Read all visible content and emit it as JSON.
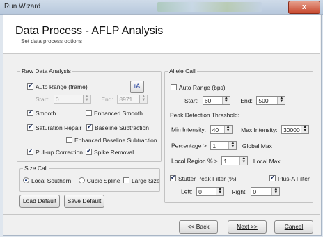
{
  "window": {
    "title": "Run Wizard",
    "close_glyph": "x"
  },
  "header": {
    "title": "Data Process - AFLP Analysis",
    "subtitle": "Set data process options"
  },
  "raw_data": {
    "legend": "Raw Data Analysis",
    "auto_range_label": "Auto Range (frame)",
    "auto_range_checked": true,
    "start_label": "Start:",
    "start_value": "0",
    "end_label": "End:",
    "end_value": "8971",
    "icon_button_text": "tA",
    "smooth_label": "Smooth",
    "smooth_checked": true,
    "enhanced_smooth_label": "Enhanced Smooth",
    "enhanced_smooth_checked": false,
    "saturation_repair_label": "Saturation Repair",
    "saturation_repair_checked": true,
    "baseline_subtraction_label": "Baseline Subtraction",
    "baseline_subtraction_checked": true,
    "enhanced_baseline_label": "Enhanced Baseline Subtraction",
    "enhanced_baseline_checked": false,
    "pullup_label": "Pull-up Correction",
    "pullup_checked": true,
    "spike_label": "Spike Removal",
    "spike_checked": true
  },
  "size_call": {
    "legend": "Size Call",
    "local_southern_label": "Local Southern",
    "cubic_spline_label": "Cubic Spline",
    "large_size_label": "Large Size",
    "selected": "Local Southern"
  },
  "allele_call": {
    "legend": "Allele Call",
    "auto_range_label": "Auto Range (bps)",
    "auto_range_checked": false,
    "start_label": "Start:",
    "start_value": "60",
    "end_label": "End:",
    "end_value": "500",
    "peak_threshold_label": "Peak Detection Threshold:",
    "min_intensity_label": "Min Intensity:",
    "min_intensity_value": "40",
    "max_intensity_label": "Max Intensity:",
    "max_intensity_value": "30000",
    "percentage_label": "Percentage >",
    "percentage_value": "1",
    "global_max_label": "Global Max",
    "local_region_label": "Local Region % >",
    "local_region_value": "1",
    "local_max_label": "Local Max",
    "stutter_label": "Stutter Peak Filter (%)",
    "stutter_checked": true,
    "plus_a_label": "Plus-A Filter",
    "plus_a_checked": true,
    "left_label": "Left:",
    "left_value": "0",
    "right_label": "Right:",
    "right_value": "0"
  },
  "buttons": {
    "load_default": "Load Default",
    "save_default": "Save Default",
    "back": "<< Back",
    "next": "Next >>",
    "cancel": "Cancel"
  },
  "icons": {
    "spinner": "spinner-arrows",
    "close": "close-icon"
  }
}
